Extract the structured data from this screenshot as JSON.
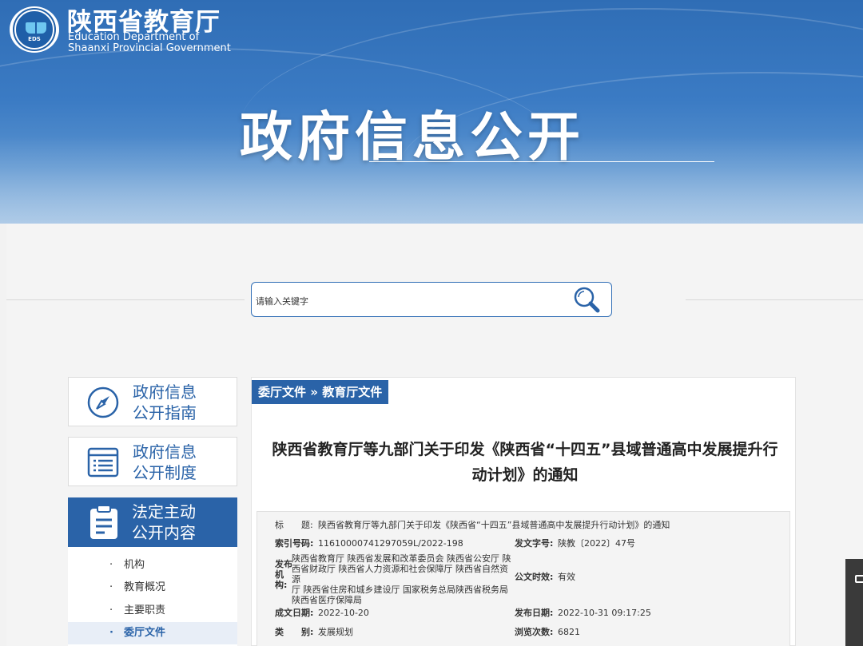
{
  "header": {
    "org_cn": "陕西省教育厅",
    "org_en_line1": "Education Department of",
    "org_en_line2": "Shaanxi Provincial Government",
    "logo_text": "EDS",
    "banner_title": "政府信息公开"
  },
  "search": {
    "placeholder": "请输入关键字",
    "icon": "search-icon"
  },
  "sidebar": {
    "boxes": [
      {
        "line1": "政府信息",
        "line2": "公开指南",
        "icon": "compass-icon"
      },
      {
        "line1": "政府信息",
        "line2": "公开制度",
        "icon": "list-icon"
      }
    ],
    "active": {
      "line1": "法定主动",
      "line2": "公开内容",
      "icon": "clipboard-icon"
    },
    "items": [
      {
        "label": "机构"
      },
      {
        "label": "教育概况"
      },
      {
        "label": "主要职责"
      },
      {
        "label": "委厅文件"
      }
    ]
  },
  "breadcrumb": {
    "level1": "委厅文件",
    "separator": "»",
    "level2": "教育厅文件"
  },
  "article": {
    "title_line1": "陕西省教育厅等九部门关于印发《陕西省“十四五”县域普通高中发展提升行",
    "title_line2": "动计划》的通知"
  },
  "meta": {
    "title_label": "标　　题:",
    "title_value": "陕西省教育厅等九部门关于印发《陕西省“十四五”县域普通高中发展提升行动计划》的通知",
    "index_label": "索引号码:",
    "index_value": "11610000741297059L/2022-198",
    "doc_no_label": "发文字号:",
    "doc_no_value": "陕教〔2022〕47号",
    "issuer_label_1": "发布",
    "issuer_label_2": "机",
    "issuer_label_3": "构:",
    "issuer_line1": "陕西省教育厅 陕西省发展和改革委员会 陕西省公安厅 陕",
    "issuer_line2": "西省财政厅 陕西省人力资源和社会保障厅 陕西省自然资源",
    "issuer_line3": "厅 陕西省住房和城乡建设厅 国家税务总局陕西省税务局",
    "issuer_line4": "陕西省医疗保障局",
    "validity_label": "公文时效:",
    "validity_value": "有效",
    "created_label": "成文日期:",
    "created_value": "2022-10-20",
    "published_label": "发布日期:",
    "published_value": "2022-10-31 09:17:25",
    "category_label": "类　　别:",
    "category_value": "发展规划",
    "views_label": "浏览次数:",
    "views_value": "6821"
  },
  "colors": {
    "brand_blue": "#2a63a8",
    "banner_blue": "#3b7bc4"
  }
}
